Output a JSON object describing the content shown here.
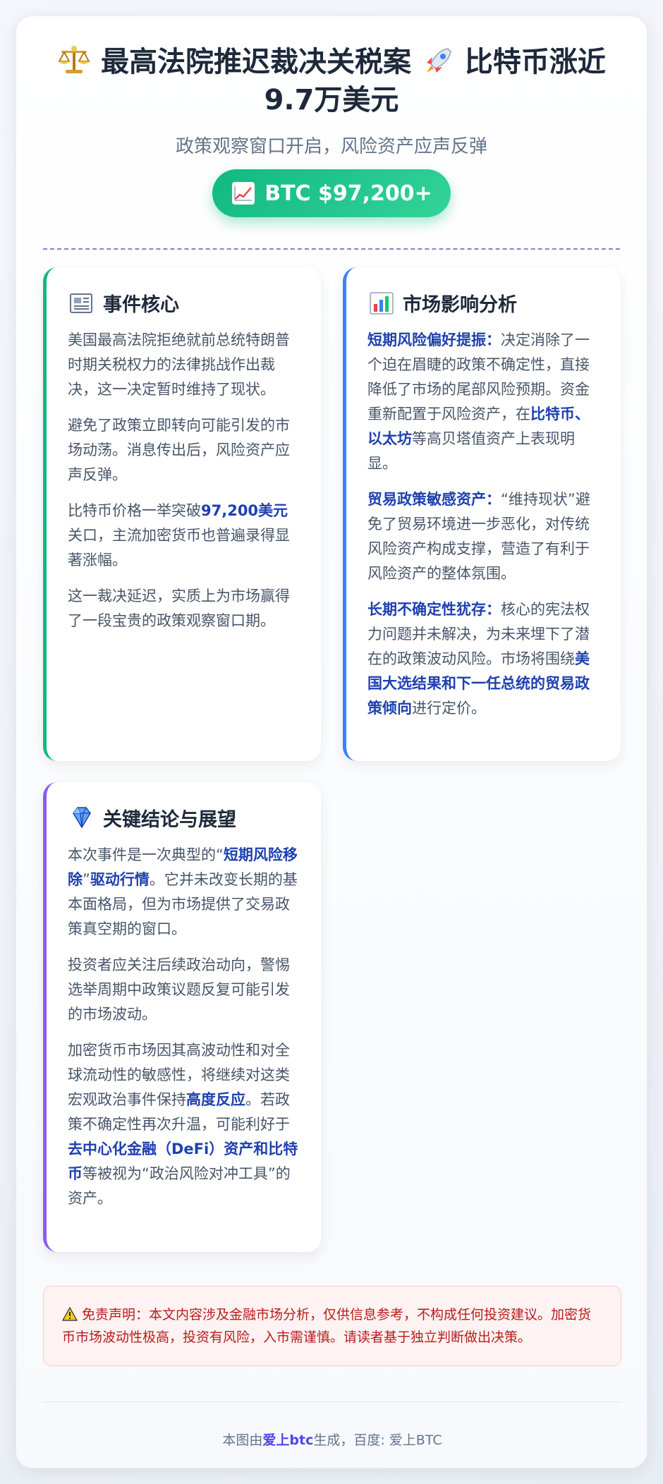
{
  "header": {
    "title": "最高法院推迟裁决关税案",
    "title_2": "比特币涨近9.7万美元",
    "subtitle": "政策观察窗口开启，风险资产应声反弹",
    "price_badge": "BTC $97,200+"
  },
  "cards": {
    "event": {
      "title": "事件核心",
      "p1": "美国最高法院拒绝就前总统特朗普时期关税权力的法律挑战作出裁决，这一决定暂时维持了现状。",
      "p2": "避免了政策立即转向可能引发的市场动荡。消息传出后，风险资产应声反弹。",
      "p3_a": "比特币价格一举突破",
      "p3_hl": "97,200美元",
      "p3_b": "关口，主流加密货币也普遍录得显著涨幅。",
      "p4": "这一裁决延迟，实质上为市场赢得了一段宝贵的政策观察窗口期。"
    },
    "impact": {
      "title": "市场影响分析",
      "s1_label": "短期风险偏好提振：",
      "s1_a": "决定消除了一个迫在眉睫的政策不确定性，直接降低了市场的尾部风险预期。资金重新配置于风险资产，在",
      "s1_hl": "比特币、以太坊",
      "s1_b": "等高贝塔值资产上表现明显。",
      "s2_label": "贸易政策敏感资产：",
      "s2_text": "“维持现状”避免了贸易环境进一步恶化，对传统风险资产构成支撑，营造了有利于风险资产的整体氛围。",
      "s3_label": "长期不确定性犹存：",
      "s3_a": "核心的宪法权力问题并未解决，为未来埋下了潜在的政策波动风险。市场将围绕",
      "s3_hl": "美国大选结果和下一任总统的贸易政策倾向",
      "s3_b": "进行定价。"
    },
    "outlook": {
      "title": "关键结论与展望",
      "p1_a": "本次事件是一次典型的“",
      "p1_hl": "短期风险移除",
      "p1_b": "”",
      "p1_hl2": "驱动行情",
      "p1_c": "。它并未改变长期的基本面格局，但为市场提供了交易政策真空期的窗口。",
      "p2": "投资者应关注后续政治动向，警惕选举周期中政策议题反复可能引发的市场波动。",
      "p3_a": "加密货币市场因其高波动性和对全球流动性的敏感性，将继续对这类宏观政治事件保持",
      "p3_hl": "高度反应",
      "p3_b": "。若政策不确定性再次升温，可能利好于",
      "p3_hl2": "去中心化金融（DeFi）资产和比特币",
      "p3_c": "等被视为“政治风险对冲工具”的资产。"
    }
  },
  "disclaimer": "免责声明：本文内容涉及金融市场分析，仅供信息参考，不构成任何投资建议。加密货币市场波动性极高，投资有风险，入市需谨慎。请读者基于独立判断做出决策。",
  "footer": {
    "prefix": "本图由",
    "brand": "爱上btc",
    "suffix": "生成，百度: 爱上BTC"
  },
  "colors": {
    "accent_green": "#10b981",
    "accent_blue": "#3b82f6",
    "accent_purple": "#8b5cf6",
    "highlight": "#1e40af"
  },
  "icons": [
    "scales-icon",
    "rocket-icon",
    "chart-up-icon",
    "newspaper-icon",
    "bar-chart-icon",
    "gem-icon",
    "warning-icon"
  ]
}
